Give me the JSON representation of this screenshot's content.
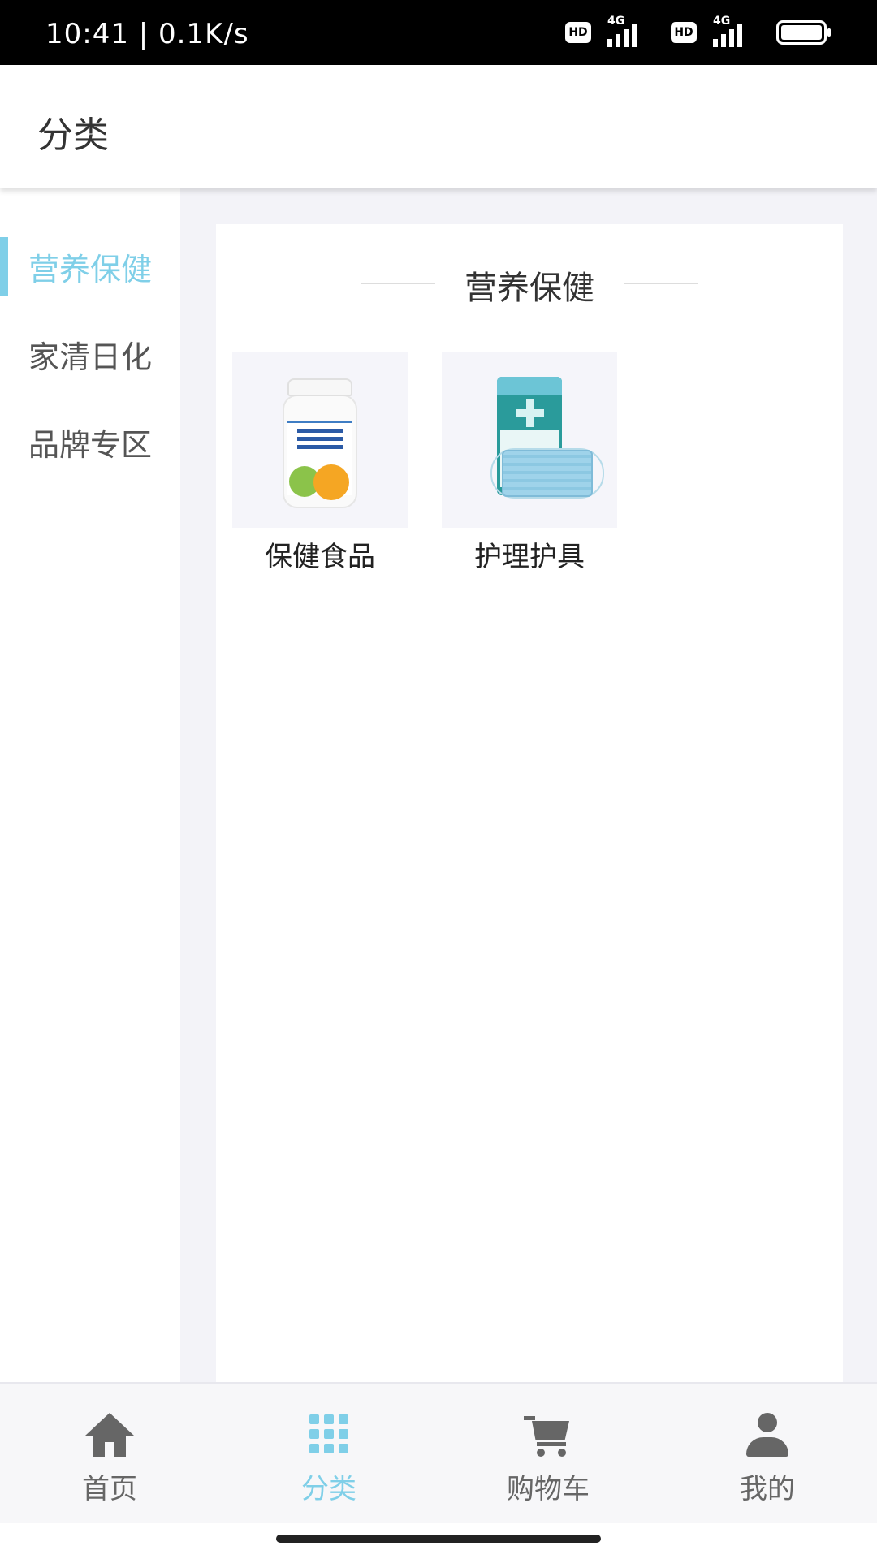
{
  "status_bar": {
    "time_speed": "10:41 | 0.1K/s",
    "hd_label": "HD",
    "network_label": "4G"
  },
  "header": {
    "title": "分类"
  },
  "sidebar": {
    "items": [
      {
        "label": "营养保健",
        "active": true
      },
      {
        "label": "家清日化",
        "active": false
      },
      {
        "label": "品牌专区",
        "active": false
      }
    ]
  },
  "content": {
    "section_title": "营养保健",
    "products": [
      {
        "label": "保健食品",
        "icon": "vitamin-bottle-icon"
      },
      {
        "label": "护理护具",
        "icon": "face-mask-icon"
      }
    ]
  },
  "bottom_nav": {
    "items": [
      {
        "label": "首页",
        "icon": "home-icon",
        "active": false
      },
      {
        "label": "分类",
        "icon": "grid-icon",
        "active": true
      },
      {
        "label": "购物车",
        "icon": "cart-icon",
        "active": false
      },
      {
        "label": "我的",
        "icon": "user-icon",
        "active": false
      }
    ]
  },
  "colors": {
    "accent": "#7fcfe8",
    "text_primary": "#333333",
    "text_secondary": "#666666",
    "content_bg": "#f3f3f8"
  }
}
